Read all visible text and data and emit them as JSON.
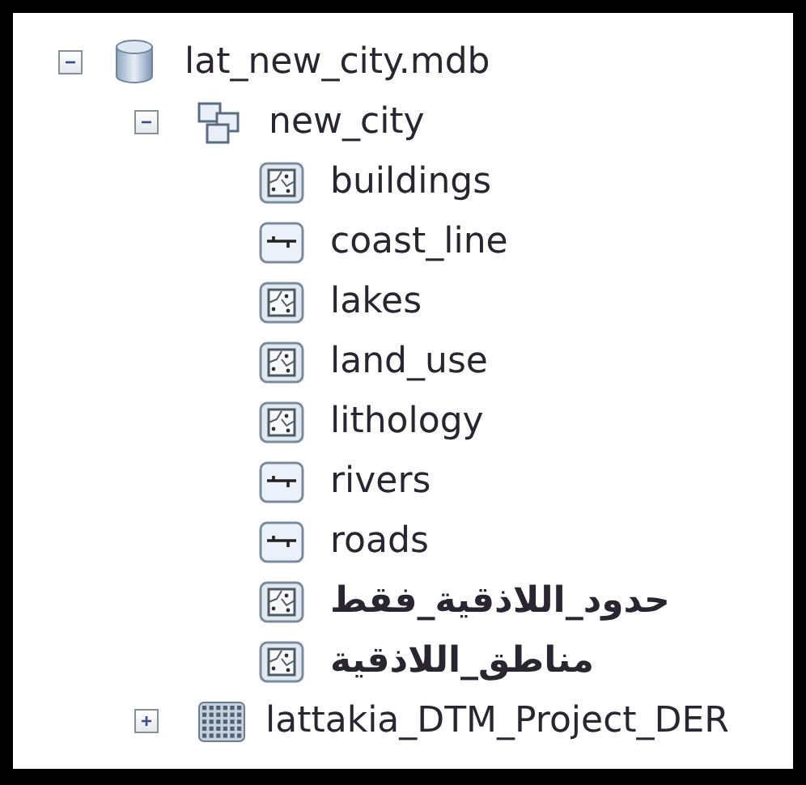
{
  "tree": [
    {
      "label": "lat_new_city.mdb",
      "kind": "database",
      "expanded": true,
      "children": [
        {
          "label": "new_city",
          "kind": "dataset",
          "expanded": true,
          "children": [
            {
              "label": "buildings",
              "kind": "polygon"
            },
            {
              "label": "coast_line",
              "kind": "line"
            },
            {
              "label": "lakes",
              "kind": "polygon"
            },
            {
              "label": "land_use",
              "kind": "polygon"
            },
            {
              "label": "lithology",
              "kind": "polygon"
            },
            {
              "label": "rivers",
              "kind": "line"
            },
            {
              "label": "roads",
              "kind": "line"
            },
            {
              "label": "حدود_اللاذقية_فقط",
              "kind": "polygon"
            },
            {
              "label": "مناطق_اللاذقية",
              "kind": "polygon"
            }
          ]
        },
        {
          "label": "lattakia_DTM_Project_DER",
          "kind": "raster",
          "expanded": false
        }
      ]
    }
  ]
}
